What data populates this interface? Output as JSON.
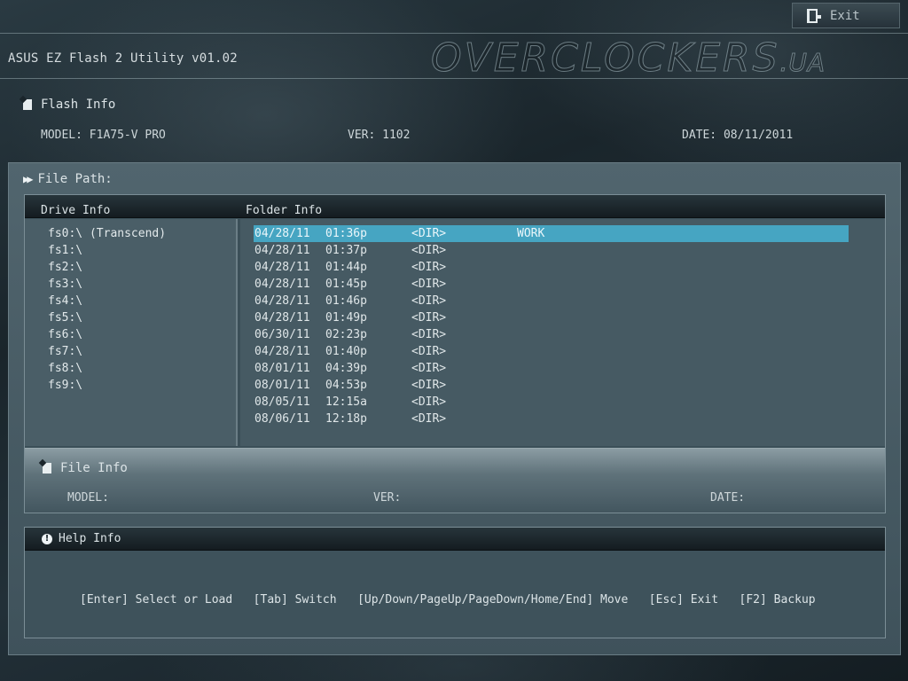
{
  "header": {
    "exit_label": "Exit",
    "app_title": "ASUS EZ Flash 2 Utility v01.02",
    "logo_main": "OVERCLOCKERS",
    "logo_suffix": ".UA"
  },
  "flash_info": {
    "title": "Flash Info",
    "model": "MODEL: F1A75-V PRO",
    "ver": "VER: 1102",
    "date": "DATE: 08/11/2011"
  },
  "file_path": {
    "label": "File Path:"
  },
  "browser": {
    "drive_header": "Drive Info",
    "folder_header": "Folder Info",
    "drives": [
      "fs0:\\ (Transcend)",
      "fs1:\\",
      "fs2:\\",
      "fs3:\\",
      "fs4:\\",
      "fs5:\\",
      "fs6:\\",
      "fs7:\\",
      "fs8:\\",
      "fs9:\\"
    ],
    "folders": [
      {
        "date": "04/28/11",
        "time": "01:36p",
        "type": "<DIR>",
        "name": "WORK"
      },
      {
        "date": "04/28/11",
        "time": "01:37p",
        "type": "<DIR>",
        "name": ""
      },
      {
        "date": "04/28/11",
        "time": "01:44p",
        "type": "<DIR>",
        "name": ""
      },
      {
        "date": "04/28/11",
        "time": "01:45p",
        "type": "<DIR>",
        "name": ""
      },
      {
        "date": "04/28/11",
        "time": "01:46p",
        "type": "<DIR>",
        "name": ""
      },
      {
        "date": "04/28/11",
        "time": "01:49p",
        "type": "<DIR>",
        "name": ""
      },
      {
        "date": "06/30/11",
        "time": "02:23p",
        "type": "<DIR>",
        "name": ""
      },
      {
        "date": "04/28/11",
        "time": "01:40p",
        "type": "<DIR>",
        "name": ""
      },
      {
        "date": "08/01/11",
        "time": "04:39p",
        "type": "<DIR>",
        "name": ""
      },
      {
        "date": "08/01/11",
        "time": "04:53p",
        "type": "<DIR>",
        "name": ""
      },
      {
        "date": "08/05/11",
        "time": "12:15a",
        "type": "<DIR>",
        "name": ""
      },
      {
        "date": "08/06/11",
        "time": "12:18p",
        "type": "<DIR>",
        "name": ""
      }
    ]
  },
  "file_info": {
    "title": "File Info",
    "model": "MODEL:",
    "ver": "VER:",
    "date": "DATE:"
  },
  "help": {
    "title": "Help Info",
    "text": "[Enter] Select or Load   [Tab] Switch   [Up/Down/PageUp/PageDown/Home/End] Move   [Esc] Exit   [F2] Backup"
  }
}
